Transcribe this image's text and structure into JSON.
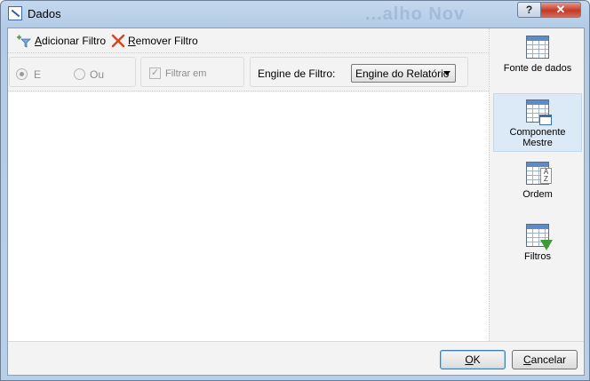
{
  "window": {
    "title": "Dados",
    "ghost_title": "...alho Nov",
    "help_label": "?",
    "close_label": "✕"
  },
  "toolbar": {
    "add_filter": {
      "underlined": "A",
      "rest": "dicionar Filtro",
      "icon": "add-filter-icon"
    },
    "remove_filter": {
      "underlined": "R",
      "rest": "emover Filtro",
      "icon": "remove-filter-icon"
    }
  },
  "options": {
    "radio_and": {
      "label": "E",
      "selected": true
    },
    "radio_or": {
      "label": "Ou",
      "selected": false
    },
    "filter_in": {
      "label": "Filtrar em",
      "checked": true
    },
    "engine": {
      "label": "Engine de Filtro:",
      "value": "Engine do Relatório"
    }
  },
  "sidebar": {
    "items": [
      {
        "label": "Fonte de dados",
        "icon": "data-source-icon",
        "active": false
      },
      {
        "label": "Componente Mestre",
        "icon": "master-component-icon",
        "active": true
      },
      {
        "label": "Ordem",
        "icon": "sort-order-icon",
        "active": false
      },
      {
        "label": "Filtros",
        "icon": "filter-icon",
        "active": false
      }
    ]
  },
  "footer": {
    "ok": {
      "underlined": "O",
      "rest": "K"
    },
    "cancel": {
      "underlined": "C",
      "rest": "ancelar"
    }
  },
  "colors": {
    "accent": "#3c7fb1",
    "active_item_bg": "#dce9f6",
    "remove_icon": "#d9441f",
    "filter_green": "#3f9a3a"
  }
}
